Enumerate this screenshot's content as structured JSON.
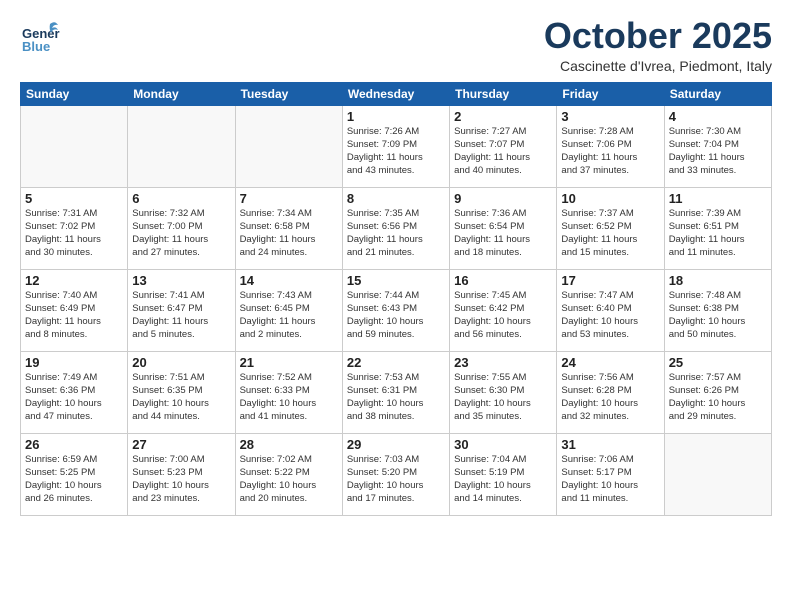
{
  "header": {
    "logo_general": "General",
    "logo_blue": "Blue",
    "month": "October 2025",
    "location": "Cascinette d'Ivrea, Piedmont, Italy"
  },
  "weekdays": [
    "Sunday",
    "Monday",
    "Tuesday",
    "Wednesday",
    "Thursday",
    "Friday",
    "Saturday"
  ],
  "weeks": [
    [
      {
        "day": "",
        "info": ""
      },
      {
        "day": "",
        "info": ""
      },
      {
        "day": "",
        "info": ""
      },
      {
        "day": "1",
        "info": "Sunrise: 7:26 AM\nSunset: 7:09 PM\nDaylight: 11 hours\nand 43 minutes."
      },
      {
        "day": "2",
        "info": "Sunrise: 7:27 AM\nSunset: 7:07 PM\nDaylight: 11 hours\nand 40 minutes."
      },
      {
        "day": "3",
        "info": "Sunrise: 7:28 AM\nSunset: 7:06 PM\nDaylight: 11 hours\nand 37 minutes."
      },
      {
        "day": "4",
        "info": "Sunrise: 7:30 AM\nSunset: 7:04 PM\nDaylight: 11 hours\nand 33 minutes."
      }
    ],
    [
      {
        "day": "5",
        "info": "Sunrise: 7:31 AM\nSunset: 7:02 PM\nDaylight: 11 hours\nand 30 minutes."
      },
      {
        "day": "6",
        "info": "Sunrise: 7:32 AM\nSunset: 7:00 PM\nDaylight: 11 hours\nand 27 minutes."
      },
      {
        "day": "7",
        "info": "Sunrise: 7:34 AM\nSunset: 6:58 PM\nDaylight: 11 hours\nand 24 minutes."
      },
      {
        "day": "8",
        "info": "Sunrise: 7:35 AM\nSunset: 6:56 PM\nDaylight: 11 hours\nand 21 minutes."
      },
      {
        "day": "9",
        "info": "Sunrise: 7:36 AM\nSunset: 6:54 PM\nDaylight: 11 hours\nand 18 minutes."
      },
      {
        "day": "10",
        "info": "Sunrise: 7:37 AM\nSunset: 6:52 PM\nDaylight: 11 hours\nand 15 minutes."
      },
      {
        "day": "11",
        "info": "Sunrise: 7:39 AM\nSunset: 6:51 PM\nDaylight: 11 hours\nand 11 minutes."
      }
    ],
    [
      {
        "day": "12",
        "info": "Sunrise: 7:40 AM\nSunset: 6:49 PM\nDaylight: 11 hours\nand 8 minutes."
      },
      {
        "day": "13",
        "info": "Sunrise: 7:41 AM\nSunset: 6:47 PM\nDaylight: 11 hours\nand 5 minutes."
      },
      {
        "day": "14",
        "info": "Sunrise: 7:43 AM\nSunset: 6:45 PM\nDaylight: 11 hours\nand 2 minutes."
      },
      {
        "day": "15",
        "info": "Sunrise: 7:44 AM\nSunset: 6:43 PM\nDaylight: 10 hours\nand 59 minutes."
      },
      {
        "day": "16",
        "info": "Sunrise: 7:45 AM\nSunset: 6:42 PM\nDaylight: 10 hours\nand 56 minutes."
      },
      {
        "day": "17",
        "info": "Sunrise: 7:47 AM\nSunset: 6:40 PM\nDaylight: 10 hours\nand 53 minutes."
      },
      {
        "day": "18",
        "info": "Sunrise: 7:48 AM\nSunset: 6:38 PM\nDaylight: 10 hours\nand 50 minutes."
      }
    ],
    [
      {
        "day": "19",
        "info": "Sunrise: 7:49 AM\nSunset: 6:36 PM\nDaylight: 10 hours\nand 47 minutes."
      },
      {
        "day": "20",
        "info": "Sunrise: 7:51 AM\nSunset: 6:35 PM\nDaylight: 10 hours\nand 44 minutes."
      },
      {
        "day": "21",
        "info": "Sunrise: 7:52 AM\nSunset: 6:33 PM\nDaylight: 10 hours\nand 41 minutes."
      },
      {
        "day": "22",
        "info": "Sunrise: 7:53 AM\nSunset: 6:31 PM\nDaylight: 10 hours\nand 38 minutes."
      },
      {
        "day": "23",
        "info": "Sunrise: 7:55 AM\nSunset: 6:30 PM\nDaylight: 10 hours\nand 35 minutes."
      },
      {
        "day": "24",
        "info": "Sunrise: 7:56 AM\nSunset: 6:28 PM\nDaylight: 10 hours\nand 32 minutes."
      },
      {
        "day": "25",
        "info": "Sunrise: 7:57 AM\nSunset: 6:26 PM\nDaylight: 10 hours\nand 29 minutes."
      }
    ],
    [
      {
        "day": "26",
        "info": "Sunrise: 6:59 AM\nSunset: 5:25 PM\nDaylight: 10 hours\nand 26 minutes."
      },
      {
        "day": "27",
        "info": "Sunrise: 7:00 AM\nSunset: 5:23 PM\nDaylight: 10 hours\nand 23 minutes."
      },
      {
        "day": "28",
        "info": "Sunrise: 7:02 AM\nSunset: 5:22 PM\nDaylight: 10 hours\nand 20 minutes."
      },
      {
        "day": "29",
        "info": "Sunrise: 7:03 AM\nSunset: 5:20 PM\nDaylight: 10 hours\nand 17 minutes."
      },
      {
        "day": "30",
        "info": "Sunrise: 7:04 AM\nSunset: 5:19 PM\nDaylight: 10 hours\nand 14 minutes."
      },
      {
        "day": "31",
        "info": "Sunrise: 7:06 AM\nSunset: 5:17 PM\nDaylight: 10 hours\nand 11 minutes."
      },
      {
        "day": "",
        "info": ""
      }
    ]
  ]
}
